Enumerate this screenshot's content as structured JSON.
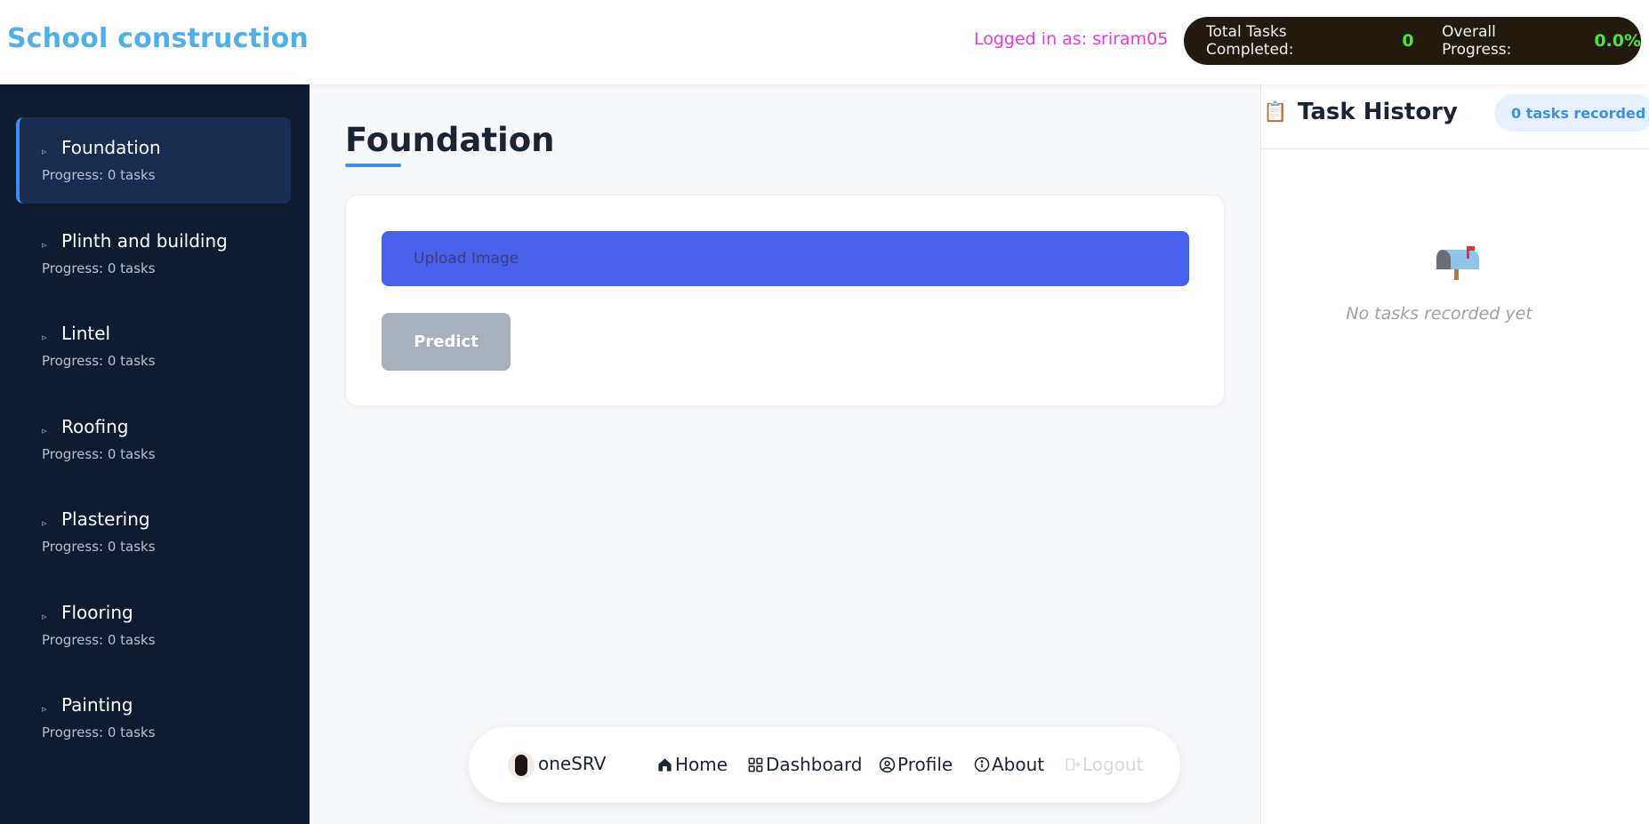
{
  "header": {
    "app_title": "School construction",
    "logged_in_text": "Logged in as: sriram05",
    "stats": {
      "total_label": "Total Tasks Completed:",
      "total_value": "0",
      "progress_label": "Overall Progress:",
      "progress_value": "0.0%"
    }
  },
  "sidebar": {
    "items": [
      {
        "label": "Foundation",
        "progress": "Progress: 0 tasks",
        "active": true
      },
      {
        "label": "Plinth and building",
        "progress": "Progress: 0 tasks"
      },
      {
        "label": "Lintel",
        "progress": "Progress: 0 tasks"
      },
      {
        "label": "Roofing",
        "progress": "Progress: 0 tasks"
      },
      {
        "label": "Plastering",
        "progress": "Progress: 0 tasks"
      },
      {
        "label": "Flooring",
        "progress": "Progress: 0 tasks"
      },
      {
        "label": "Painting",
        "progress": "Progress: 0 tasks"
      }
    ]
  },
  "main": {
    "title": "Foundation",
    "upload_label": "Upload Image",
    "predict_label": "Predict"
  },
  "bottom_nav": {
    "brand": "oneSRV",
    "links": {
      "home": "Home",
      "dashboard": "Dashboard",
      "profile": "Profile",
      "about": "About",
      "logout": "Logout"
    }
  },
  "history": {
    "icon": "clipboard-icon",
    "title": "Task History",
    "badge": "0 tasks recorded",
    "empty_icon": "mailbox-icon",
    "empty_text": "No tasks recorded yet"
  },
  "colors": {
    "accent": "#3d8fe8",
    "title": "#4fb0e8",
    "logged_in": "#e83ad6",
    "upload_button": "#4761ec",
    "sidebar_bg": "#0f1b2f",
    "stat_value": "#4ee03f"
  }
}
